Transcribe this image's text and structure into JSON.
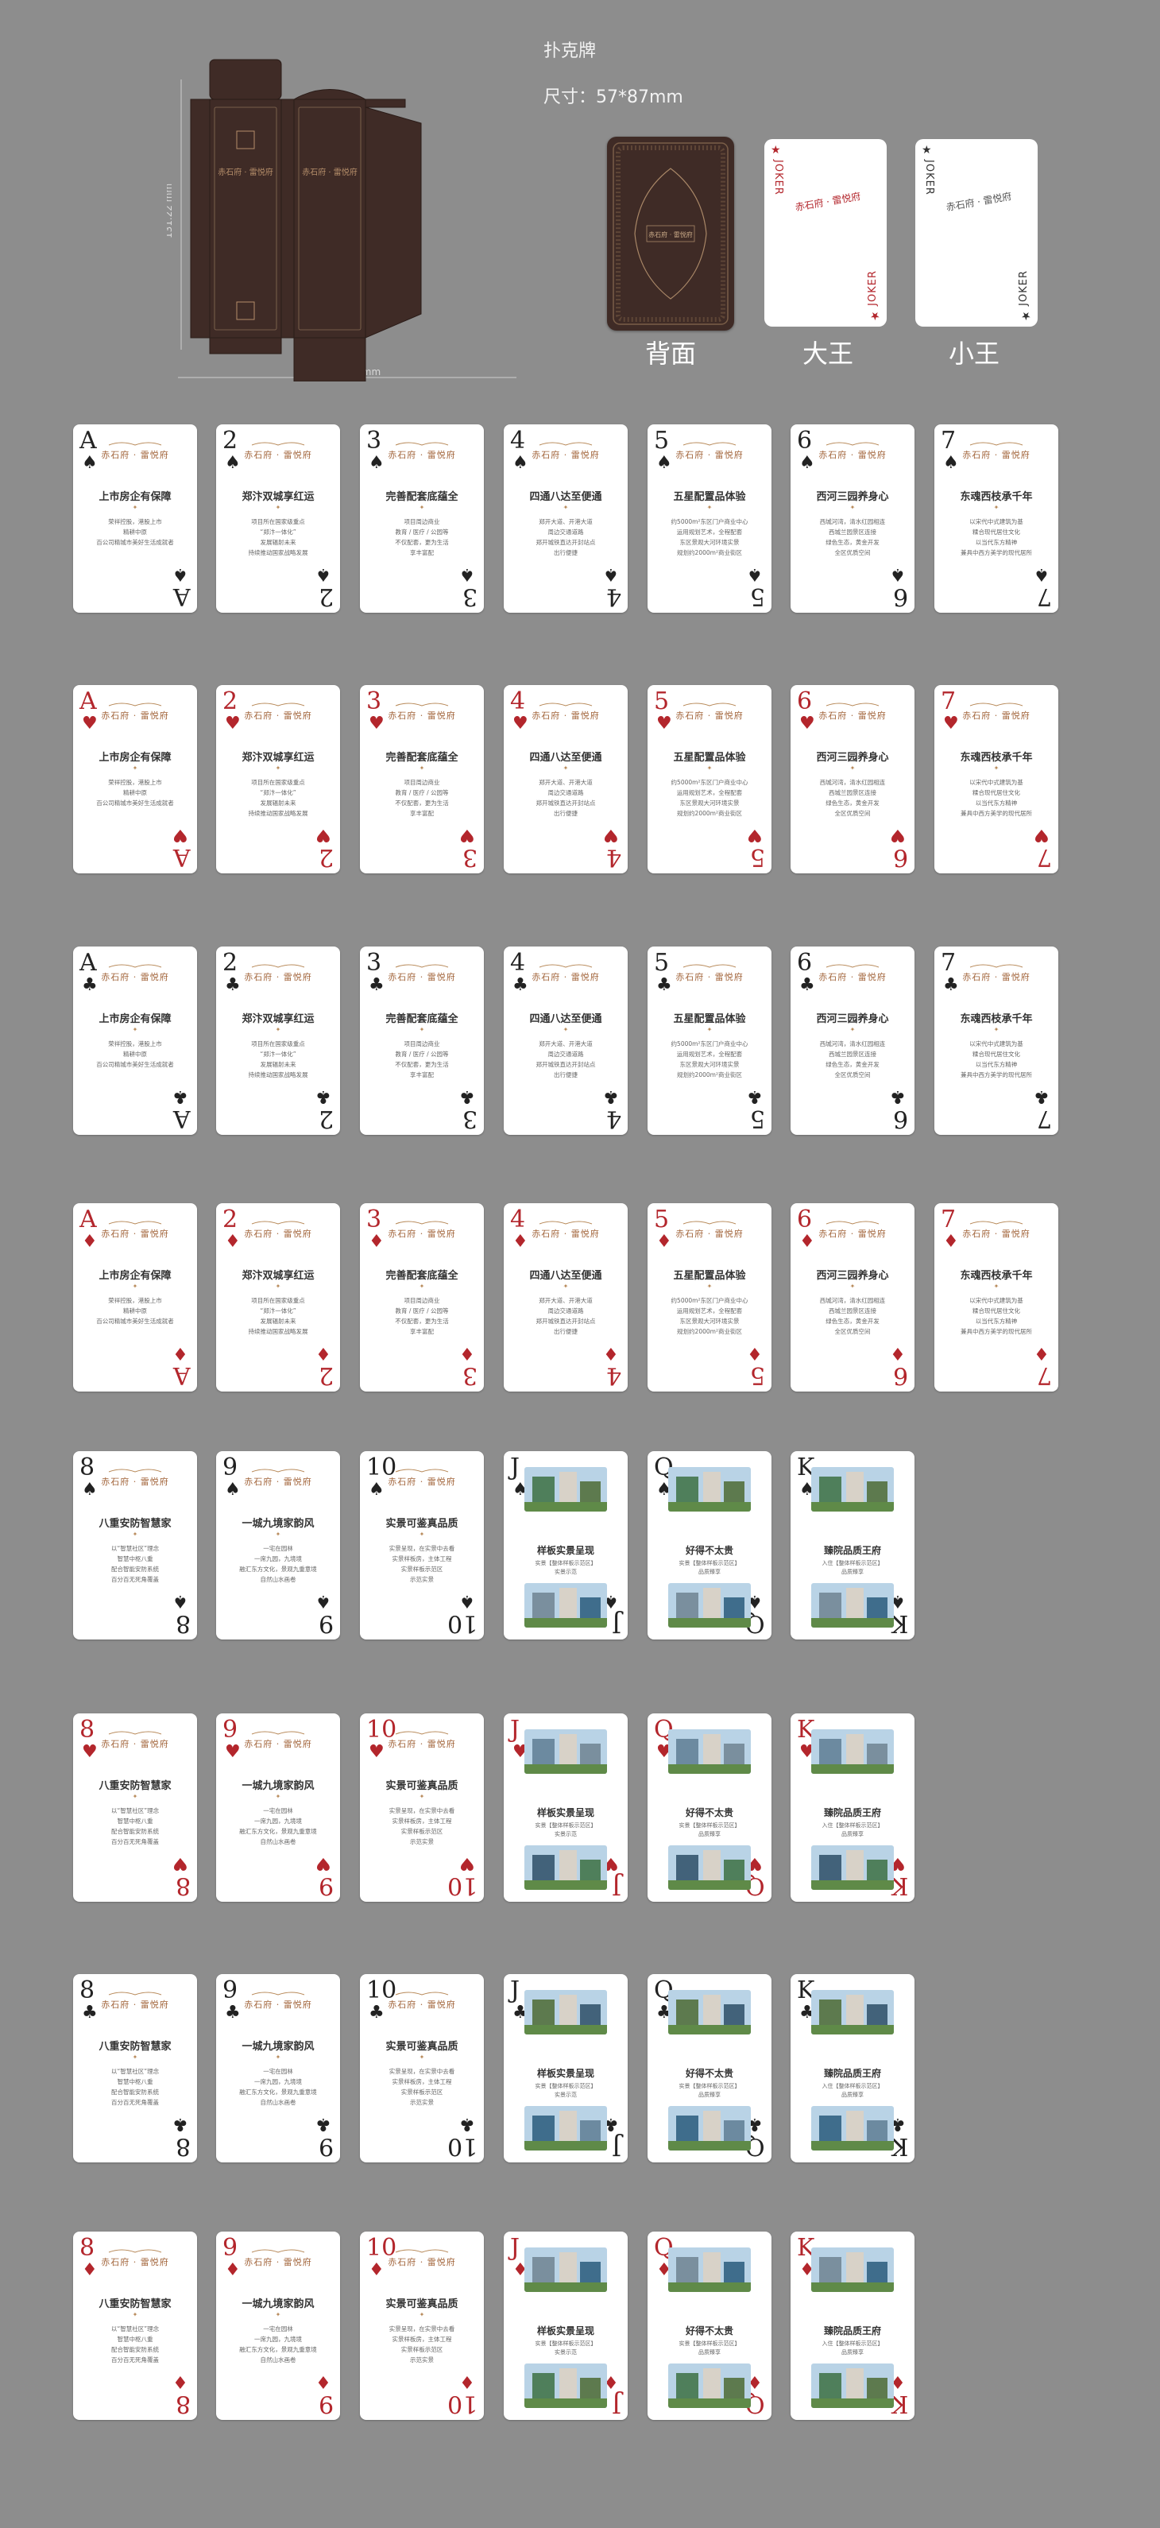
{
  "header": {
    "title": "扑克牌",
    "size_label": "尺寸：57*87mm",
    "dieline_height_label": "131.22 mm",
    "dieline_width_label": "162.01 mm"
  },
  "captions": {
    "back": "背面",
    "big_joker": "大王",
    "small_joker": "小王"
  },
  "joker_text": "JOKER",
  "brand": "赤石府 · 雷悦府",
  "colors": {
    "box": "#3f2b26",
    "red_suit": "#b3262c",
    "black_suit": "#222222",
    "accent": "#a2643a",
    "background": "#8d8d8d"
  },
  "number_cards": [
    {
      "rank": "A",
      "heading": "上市房企有保障",
      "body": [
        "荣祥控股，港股上市",
        "精耕中原",
        "百公司精城市美好生活成就者"
      ]
    },
    {
      "rank": "2",
      "heading": "郑汴双城享红运",
      "body": [
        "项目所在国家级重点",
        "“郑汴一体化”",
        "发展辐射未来",
        "持续推动国家战略发展"
      ]
    },
    {
      "rank": "3",
      "heading": "完善配套底蕴全",
      "body": [
        "项目周边商业",
        "教育 / 医疗 / 公园等",
        "不仅配套，更为生活",
        "享丰富配"
      ]
    },
    {
      "rank": "4",
      "heading": "四通八达至便通",
      "body": [
        "郑开大道、开港大道",
        "周边交通道路",
        "郑开城铁直达开封站点",
        "出行便捷"
      ]
    },
    {
      "rank": "5",
      "heading": "五星配置品体验",
      "body": [
        "约5000m²东区门户商业中心",
        "运用规划艺术，全程配套",
        "东区景观大河环境实景",
        "规划约2000m²商业街区"
      ]
    },
    {
      "rank": "6",
      "heading": "西河三园养身心",
      "body": [
        "西城河湾，清水红园相连",
        "西城兰园景区连接",
        "绿色生态，黄金开发",
        "全区优质空间"
      ]
    },
    {
      "rank": "7",
      "heading": "东魂西枝承千年",
      "body": [
        "以宋代中式建筑为基",
        "糅合现代居住文化",
        "以当代东方精神",
        "兼具中西方美学的现代居所"
      ]
    }
  ],
  "high_cards": [
    {
      "rank": "8",
      "heading": "八重安防智慧家",
      "body": [
        "以“智慧社区”理念",
        "智慧中枢八重",
        "配合智能安防系统",
        "百分百无死角覆盖"
      ]
    },
    {
      "rank": "9",
      "heading": "一城九境家韵风",
      "body": [
        "一宅在园林",
        "一席九园，九境境",
        "融汇东方文化，景观九重意境",
        "自然山水画卷"
      ]
    },
    {
      "rank": "10",
      "heading": "实景可鉴真品质",
      "body": [
        "实景呈现，在实景中去看",
        "实景样板房，主体工程",
        "实景样板示范区",
        "示范实景"
      ]
    }
  ],
  "face_cards": [
    {
      "rank": "J",
      "heading": "样板实景呈现",
      "body": [
        "实景【整体样板示范区】",
        "实景示范"
      ]
    },
    {
      "rank": "Q",
      "heading": "好得不太贵",
      "body": [
        "实景【整体样板示范区】",
        "品质臻享"
      ]
    },
    {
      "rank": "K",
      "heading": "臻院品质王府",
      "body": [
        "入住【整体样板示范区】",
        "品质臻享"
      ]
    }
  ],
  "suits": [
    {
      "name": "spades",
      "symbol": "♠",
      "color": "black"
    },
    {
      "name": "hearts",
      "symbol": "♥",
      "color": "red"
    },
    {
      "name": "clubs",
      "symbol": "♣",
      "color": "black"
    },
    {
      "name": "diamonds",
      "symbol": "♦",
      "color": "red"
    }
  ]
}
